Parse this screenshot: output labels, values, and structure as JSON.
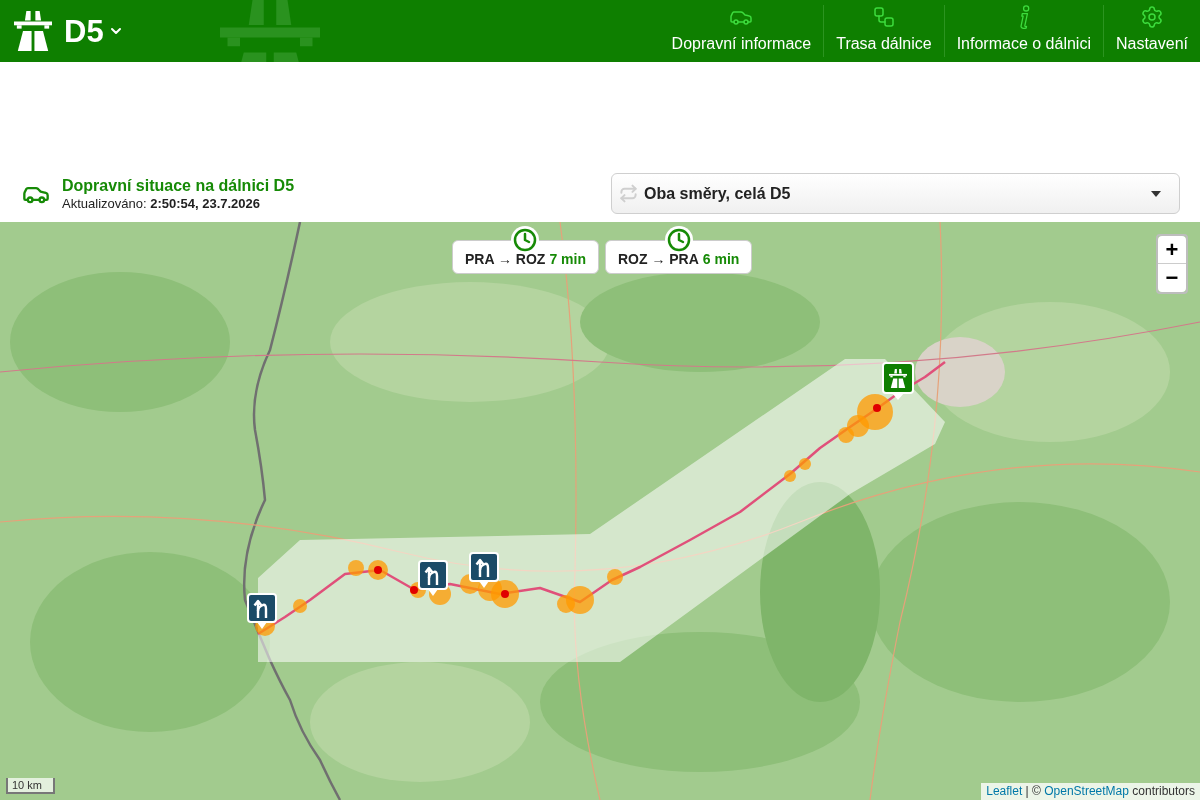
{
  "header": {
    "logo_title": "D5",
    "nav": [
      {
        "label": "Dopravní informace"
      },
      {
        "label": "Trasa dálnice"
      },
      {
        "label": "Informace o dálnici"
      },
      {
        "label": "Nastavení"
      }
    ]
  },
  "traffic_status": {
    "title": "Dopravní situace na dálnici D5",
    "updated": "Aktualizováno: **2:50:54, 23.7.2026**"
  },
  "direction_select": {
    "value": "Oba směry, celá D5"
  },
  "map": {
    "travel_times": [
      {
        "route": "PRA → ROZ",
        "duration": "7 min"
      },
      {
        "route": "ROZ → PRA",
        "duration": "6 min"
      }
    ],
    "zoom_in": "+",
    "zoom_out": "−",
    "scale": "10 km",
    "attribution": {
      "link_1": "Leaflet",
      "separator": "| ©",
      "link_2": "OpenStreetMap",
      "suffix": "contributors"
    }
  }
}
